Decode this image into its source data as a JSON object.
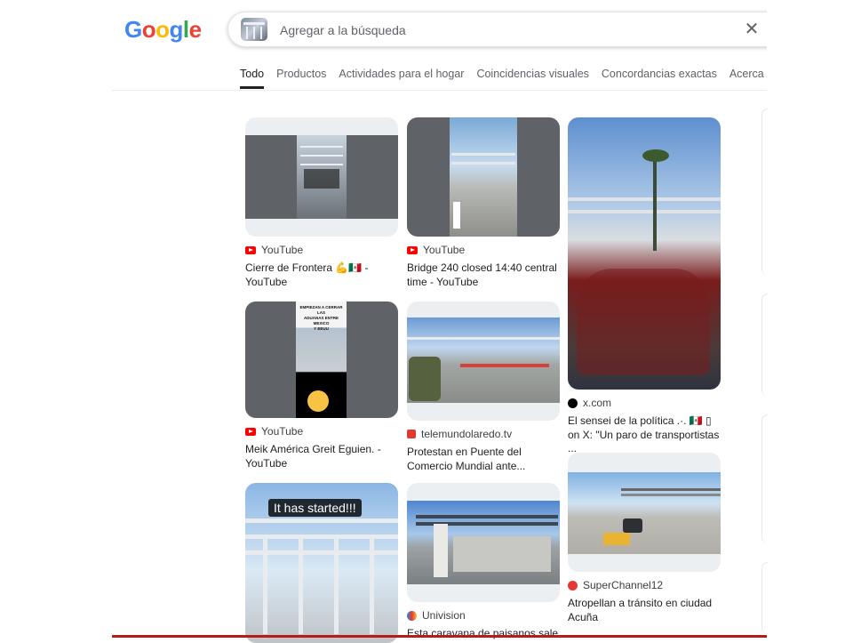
{
  "logo": {
    "letters": [
      "G",
      "o",
      "o",
      "g",
      "l",
      "e"
    ],
    "colors": [
      "#4285f4",
      "#ea4335",
      "#fbbc05",
      "#4285f4",
      "#34a853",
      "#ea4335"
    ]
  },
  "search": {
    "placeholder": "Agregar a la búsqueda",
    "close_icon": "close-icon"
  },
  "tabs": [
    "Todo",
    "Productos",
    "Actividades para el hogar",
    "Coincidencias visuales",
    "Concordancias exactas",
    "Acerca"
  ],
  "active_tab": "Todo",
  "results": [
    {
      "source": "YouTube",
      "title": "Cierre de Frontera 💪🇲🇽 - YouTube",
      "icon": "youtube-icon"
    },
    {
      "source": "YouTube",
      "title": "Bridge 240 closed 14:40 central time - YouTube",
      "icon": "youtube-icon"
    },
    {
      "source": "x.com",
      "title": "El sensei de la política .·. 🇲🇽 ▯ on X: \"Un paro de transportistas ...",
      "icon": "x-icon"
    },
    {
      "source": "YouTube",
      "title": "Meik América Greit Eguien. - YouTube",
      "icon": "youtube-icon",
      "overlay_lines": [
        "EMPIEZAN A CERRAR LAS",
        "ADUANAS ENTRE MEXICO",
        "Y EEUU"
      ]
    },
    {
      "source": "telemundolaredo.tv",
      "title": "Protestan en Puente del Comercio Mundial ante...",
      "icon": "telemundo-icon"
    },
    {
      "source": "SuperChannel12",
      "title": "Atropellan a tránsito en ciudad Acuña",
      "icon": "superchannel-icon"
    },
    {
      "overlay": "It has started!!!"
    },
    {
      "source": "Univision",
      "title": "Esta caravana de paisanos sale",
      "icon": "univision-icon"
    }
  ],
  "colors": {
    "youtube": "#ff0000",
    "accent_text": "#202124",
    "muted": "#5f6368"
  }
}
